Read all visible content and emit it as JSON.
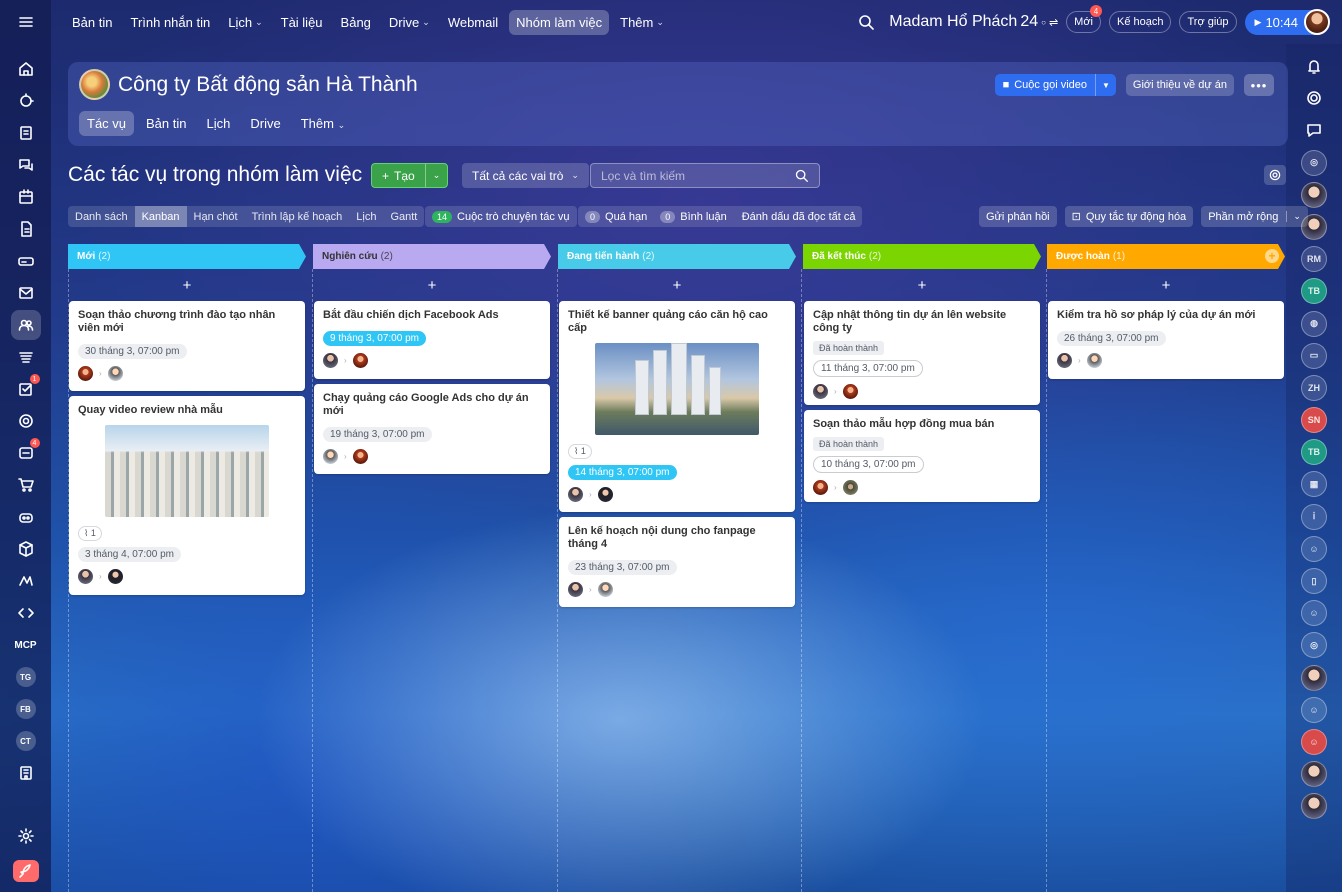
{
  "top_nav": {
    "items": [
      "Bản tin",
      "Trình nhắn tin",
      "Lịch",
      "Tài liệu",
      "Bảng",
      "Drive",
      "Webmail",
      "Nhóm làm việc",
      "Thêm"
    ],
    "user_name": "Madam Hổ Phách",
    "user_number": "24",
    "new_label": "Mới",
    "new_count": "4",
    "plan_label": "Kế hoạch",
    "help_label": "Trợ giúp",
    "clock": "10:44"
  },
  "left_sidebar": {
    "badges": {
      "tasks": "1",
      "chats": "4"
    },
    "text_items": {
      "mcp": "MCP",
      "tg": "TG",
      "fb": "FB",
      "ct": "CT"
    }
  },
  "right_sidebar": {
    "initials": [
      "RM",
      "TB",
      "ZH",
      "SN",
      "TB"
    ]
  },
  "group": {
    "title": "Công ty Bất động sản Hà Thành",
    "tabs": [
      "Tác vụ",
      "Bản tin",
      "Lịch",
      "Drive",
      "Thêm"
    ],
    "video_call_label": "Cuộc gọi video",
    "intro_label": "Giới thiệu về dự án",
    "more_label": "•••"
  },
  "page": {
    "title": "Các tác vụ trong nhóm làm việc",
    "create_label": "Tạo",
    "role_filter": "Tất cả các vai trò",
    "search_placeholder": "Lọc và tìm kiếm"
  },
  "toolbar": {
    "views": [
      "Danh sách",
      "Kanban",
      "Hạn chót",
      "Trình lập kế hoạch",
      "Lịch",
      "Gantt"
    ],
    "chat_count": "14",
    "chat_label": "Cuộc trò chuyện tác vụ",
    "overdue_count": "0",
    "overdue_label": "Quá hạn",
    "comments_count": "0",
    "comments_label": "Bình luận",
    "mark_read_label": "Đánh dấu đã đọc tất cả",
    "feedback_label": "Gửi phản hồi",
    "automation_label": "Quy tắc tự động hóa",
    "extensions_label": "Phần mở rộng"
  },
  "colors": {
    "col_new": "#2fc6f6",
    "col_research": "#b9a9f0",
    "col_progress": "#47cbe8",
    "col_done": "#7bd500",
    "col_approved": "#ffa900",
    "create_green": "#3aa34a",
    "video_blue": "#2f6df0"
  },
  "columns": [
    {
      "name": "Mới",
      "count": "(2)",
      "add": "+"
    },
    {
      "name": "Nghiên cứu",
      "count": "(2)",
      "add": "+"
    },
    {
      "name": "Đang tiến hành",
      "count": "(2)",
      "add": "+"
    },
    {
      "name": "Đã kết thúc",
      "count": "(2)",
      "add": "+"
    },
    {
      "name": "Được hoàn",
      "count": "(1)",
      "add": "+"
    }
  ],
  "cards": {
    "c1": {
      "title": "Soạn thảo chương trình đào tạo nhân viên mới",
      "deadline": "30 tháng 3, 07:00 pm"
    },
    "c2": {
      "title": "Quay video review nhà mẫu",
      "attach": "1",
      "deadline": "3 tháng 4, 07:00 pm"
    },
    "c3": {
      "title": "Bắt đầu chiến dịch Facebook Ads",
      "deadline": "9 tháng 3, 07:00 pm"
    },
    "c4": {
      "title": "Chạy quảng cáo Google Ads cho dự án mới",
      "deadline": "19 tháng 3, 07:00 pm"
    },
    "c5": {
      "title": "Thiết kế banner quảng cáo căn hộ cao cấp",
      "attach": "1",
      "deadline": "14 tháng 3, 07:00 pm"
    },
    "c6": {
      "title": "Lên kế hoạch nội dung cho fanpage tháng 4",
      "deadline": "23 tháng 3, 07:00 pm"
    },
    "c7": {
      "title": "Cập nhật thông tin dự án lên website công ty",
      "status": "Đã hoàn thành",
      "deadline": "11 tháng 3, 07:00 pm"
    },
    "c8": {
      "title": "Soạn thảo mẫu hợp đồng mua bán",
      "status": "Đã hoàn thành",
      "deadline": "10 tháng 3, 07:00 pm"
    },
    "c9": {
      "title": "Kiểm tra hồ sơ pháp lý của dự án mới",
      "deadline": "26 tháng 3, 07:00 pm"
    }
  }
}
